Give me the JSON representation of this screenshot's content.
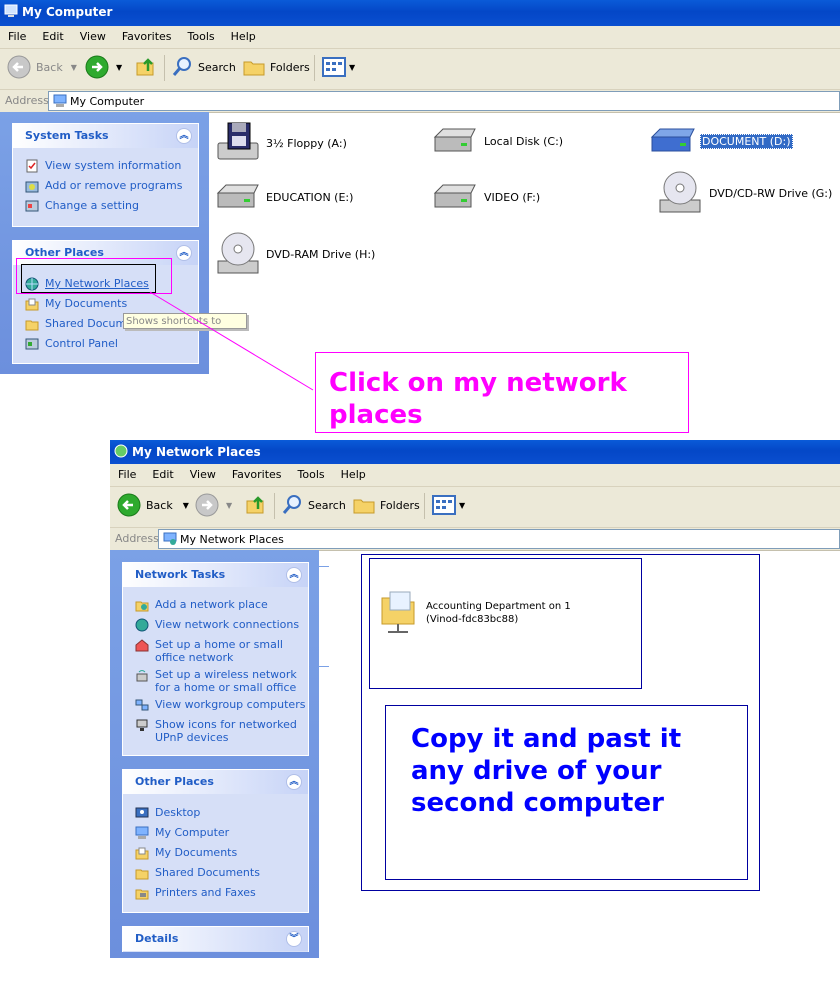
{
  "win1": {
    "title": "My Computer",
    "menu": [
      "File",
      "Edit",
      "View",
      "Favorites",
      "Tools",
      "Help"
    ],
    "toolbar": {
      "back": "Back",
      "search": "Search",
      "folders": "Folders"
    },
    "address_label": "Address",
    "address_value": "My Computer",
    "system_tasks": {
      "title": "System Tasks",
      "items": [
        "View system information",
        "Add or remove programs",
        "Change a setting"
      ]
    },
    "other_places": {
      "title": "Other Places",
      "items": [
        "My Network Places",
        "My Documents",
        "Shared Documents",
        "Control Panel"
      ]
    },
    "tooltip": "Shows shortcuts to",
    "drives": [
      {
        "label": "3½ Floppy (A:)",
        "icon": "floppy-drive-icon"
      },
      {
        "label": "Local Disk (C:)",
        "icon": "hard-disk-icon"
      },
      {
        "label": "DOCUMENT (D:)",
        "icon": "hard-disk-icon"
      },
      {
        "label": "EDUCATION (E:)",
        "icon": "hard-disk-icon"
      },
      {
        "label": "VIDEO (F:)",
        "icon": "hard-disk-icon"
      },
      {
        "label": "DVD/CD-RW Drive (G:)",
        "icon": "cd-drive-icon"
      },
      {
        "label": "DVD-RAM Drive (H:)",
        "icon": "cd-drive-icon"
      }
    ]
  },
  "callout1": {
    "line1": "Click on my network",
    "line2": "places",
    "color": "#ff00ff"
  },
  "win2": {
    "title": "My Network Places",
    "menu": [
      "File",
      "Edit",
      "View",
      "Favorites",
      "Tools",
      "Help"
    ],
    "toolbar": {
      "back": "Back",
      "search": "Search",
      "folders": "Folders"
    },
    "address_label": "Address",
    "address_value": "My Network Places",
    "network_tasks": {
      "title": "Network Tasks",
      "items": [
        {
          "l1": "Add a network place",
          "l2": ""
        },
        {
          "l1": "View network connections",
          "l2": ""
        },
        {
          "l1": "Set up a home or small",
          "l2": "office network"
        },
        {
          "l1": "Set up a wireless network",
          "l2": "for a home or small office"
        },
        {
          "l1": "View workgroup computers",
          "l2": ""
        },
        {
          "l1": "Show icons for networked",
          "l2": "UPnP devices"
        }
      ]
    },
    "other_places": {
      "title": "Other Places",
      "items": [
        "Desktop",
        "My Computer",
        "My Documents",
        "Shared Documents",
        "Printers and Faxes"
      ]
    },
    "details_title": "Details",
    "share": {
      "line1": "Accounting Department on 1",
      "line2": "(Vinod-fdc83bc88)"
    }
  },
  "callout2": {
    "line1": "Copy it and past it",
    "line2": "any drive of your",
    "line3": "second computer",
    "color": "#0000ff"
  }
}
